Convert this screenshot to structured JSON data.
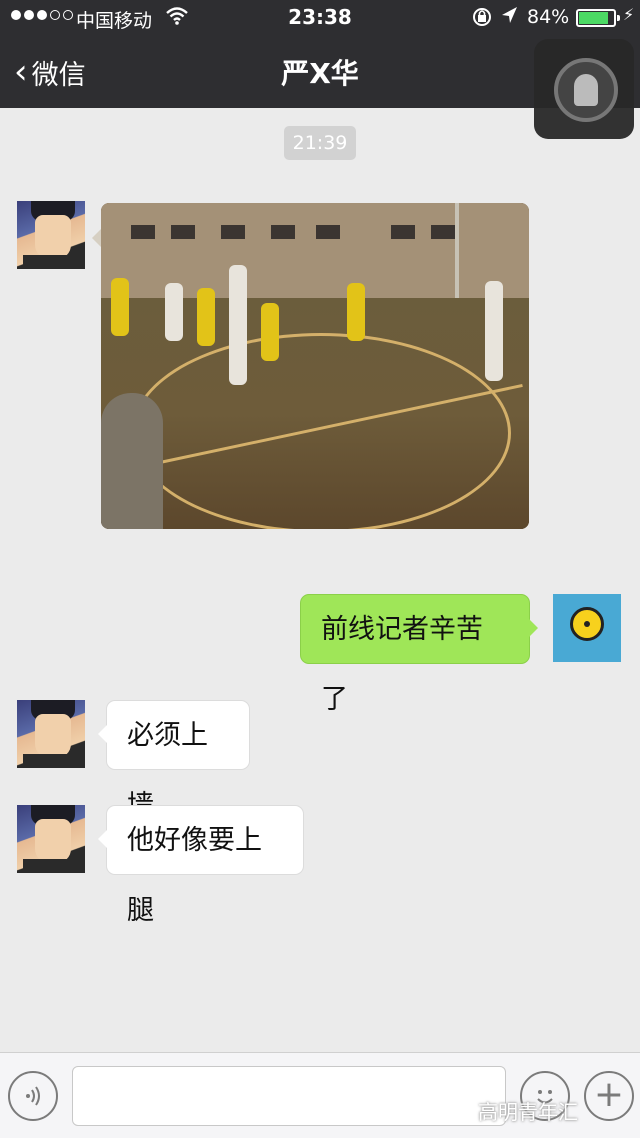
{
  "status_bar": {
    "carrier": "中国移动",
    "time": "23:38",
    "battery_percent": "84%",
    "battery_level": 0.84,
    "signal_bars": 3,
    "icons": [
      "signal-dots-icon",
      "wifi-icon",
      "orientation-lock-icon",
      "location-arrow-icon",
      "battery-icon",
      "charging-bolt-icon"
    ]
  },
  "nav": {
    "back_label": "微信",
    "title": "严X华"
  },
  "messages": {
    "timestamp": "21:39",
    "sent_text": "前线记者辛苦了",
    "reply_1": "必须上墙",
    "reply_2": "他好像要上腿"
  },
  "input_bar": {
    "icons": [
      "voice-icon",
      "emoji-icon",
      "plus-icon"
    ],
    "watermark": "高明青年汇"
  },
  "colors": {
    "bar_bg": "#2e2e31",
    "chat_bg": "#ebebeb",
    "sent_bubble": "#9fe658",
    "received_bubble": "#ffffff"
  }
}
